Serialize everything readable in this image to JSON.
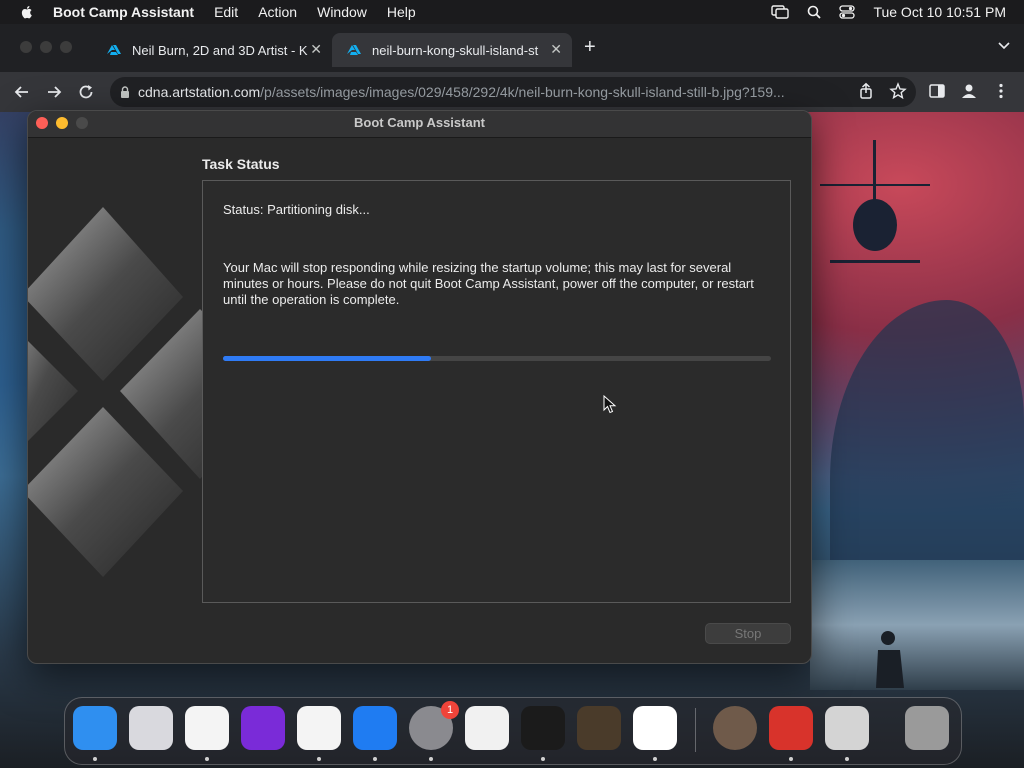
{
  "menubar": {
    "app_name": "Boot Camp Assistant",
    "items": [
      "Edit",
      "Action",
      "Window",
      "Help"
    ],
    "datetime": "Tue Oct 10  10:51 PM",
    "status_icons": [
      "screen-mirroring-icon",
      "spotlight-search-icon",
      "control-center-icon"
    ]
  },
  "browser": {
    "tabs": [
      {
        "title": "Neil Burn, 2D and 3D Artist - K",
        "active": false,
        "favicon": "artstation-icon"
      },
      {
        "title": "neil-burn-kong-skull-island-st",
        "active": true,
        "favicon": "artstation-icon"
      }
    ],
    "new_tab": "+",
    "close_glyph": "✕",
    "url_host": "cdna.artstation.com",
    "url_path": "/p/assets/images/images/029/458/292/4k/neil-burn-kong-skull-island-still-b.jpg?159..."
  },
  "window": {
    "title": "Boot Camp Assistant",
    "heading": "Task Status",
    "status": "Status: Partitioning disk...",
    "warning": "Your Mac will stop responding while resizing the startup volume; this may last for several minutes or hours. Please do not quit Boot Camp Assistant, power off the computer, or restart until the operation is complete.",
    "progress": 0.38,
    "stop_label": "Stop"
  },
  "dock": {
    "apps": [
      {
        "name": "finder-icon",
        "color": "#2f8ff0",
        "running": true
      },
      {
        "name": "launchpad-icon",
        "color": "#d9d9de",
        "running": false
      },
      {
        "name": "safari-icon",
        "color": "#f4f4f4",
        "running": true
      },
      {
        "name": "firefox-icon",
        "color": "#7a2bd8",
        "running": false
      },
      {
        "name": "chrome-icon",
        "color": "#f4f4f4",
        "running": true
      },
      {
        "name": "app-store-icon",
        "color": "#1f7cf2",
        "running": true
      },
      {
        "name": "system-settings-icon",
        "color": "#8a8a8f",
        "running": true,
        "badge": "1"
      },
      {
        "name": "textedit-icon",
        "color": "#f1f1f1",
        "running": false
      },
      {
        "name": "terminal-icon",
        "color": "#1b1b1b",
        "running": true
      },
      {
        "name": "garageband-icon",
        "color": "#4a3b2a",
        "running": false
      },
      {
        "name": "vscode-icon",
        "color": "#ffffff",
        "running": true
      },
      {
        "name": "downloads-icon",
        "color": "#6f5a4a",
        "running": false
      },
      {
        "name": "instruments-icon",
        "color": "#d8332b",
        "running": true
      },
      {
        "name": "boot-camp-assistant-icon",
        "color": "#d4d4d4",
        "running": true
      },
      {
        "name": "trash-icon",
        "color": "#9a9a9a",
        "running": false
      }
    ]
  }
}
